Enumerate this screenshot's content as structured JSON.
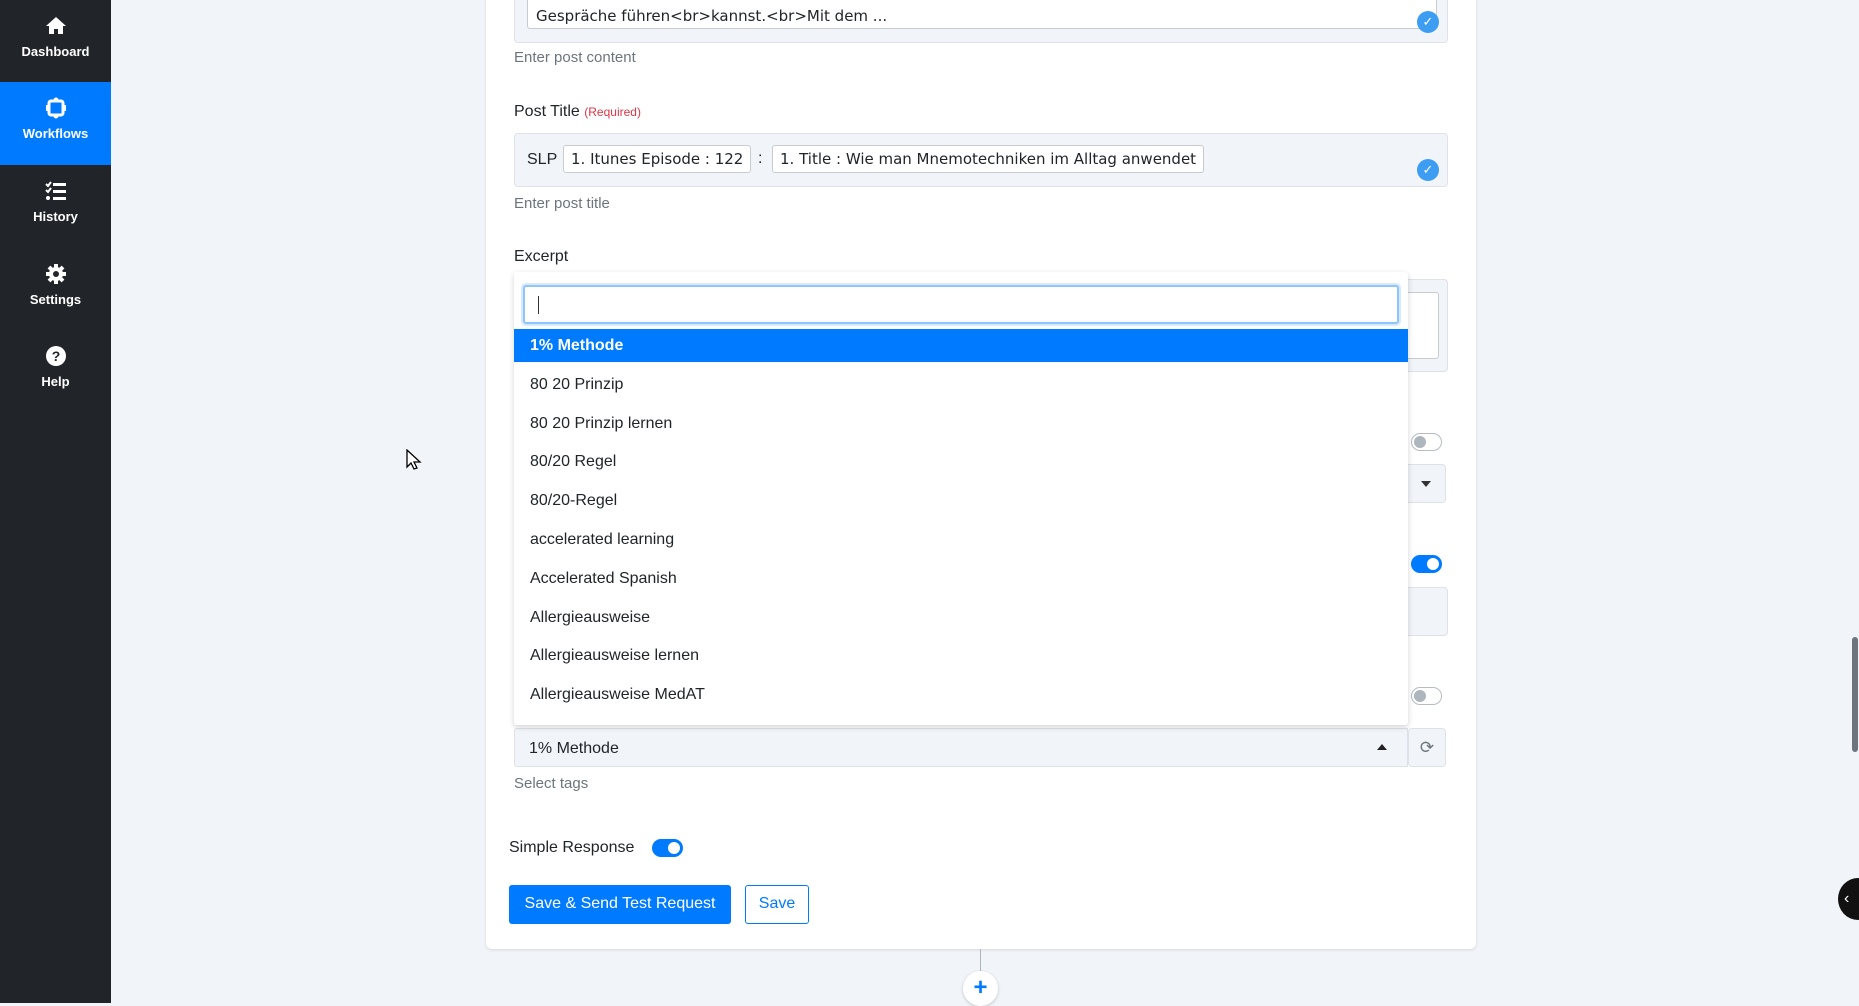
{
  "sidebar": {
    "items": [
      {
        "label": "Dashboard",
        "icon": "home-icon"
      },
      {
        "label": "Workflows",
        "icon": "workflow-icon",
        "active": true
      },
      {
        "label": "History",
        "icon": "list-check-icon"
      },
      {
        "label": "Settings",
        "icon": "gear-icon"
      },
      {
        "label": "Help",
        "icon": "question-circle-icon"
      }
    ]
  },
  "content_field": {
    "value_visible": "Gespräche führen<br>kannst.<br>Mit dem ...",
    "help": "Enter post content"
  },
  "post_title": {
    "label": "Post Title",
    "required": "(Required)",
    "prefix": "SLP",
    "chip1": "1. Itunes Episode : 122",
    "separator": ":",
    "chip2": "1. Title : Wie man Mnemotechniken im Alltag anwendet",
    "help": "Enter post title"
  },
  "excerpt": {
    "label": "Excerpt"
  },
  "tags_dropdown": {
    "search_value": "",
    "options": [
      "1% Methode",
      "80 20 Prinzip",
      "80 20 Prinzip lernen",
      "80/20 Regel",
      "80/20-Regel",
      "accelerated learning",
      "Accelerated Spanish",
      "Allergieausweise",
      "Allergieausweise lernen",
      "Allergieausweise MedAT"
    ],
    "selected": "1% Methode"
  },
  "tags": {
    "value": "1% Methode",
    "help": "Select tags"
  },
  "simple_response": {
    "label": "Simple Response",
    "enabled": true
  },
  "buttons": {
    "save_send": "Save & Send Test Request",
    "save": "Save"
  },
  "colors": {
    "accent": "#007bff",
    "sidebar": "#212529"
  }
}
